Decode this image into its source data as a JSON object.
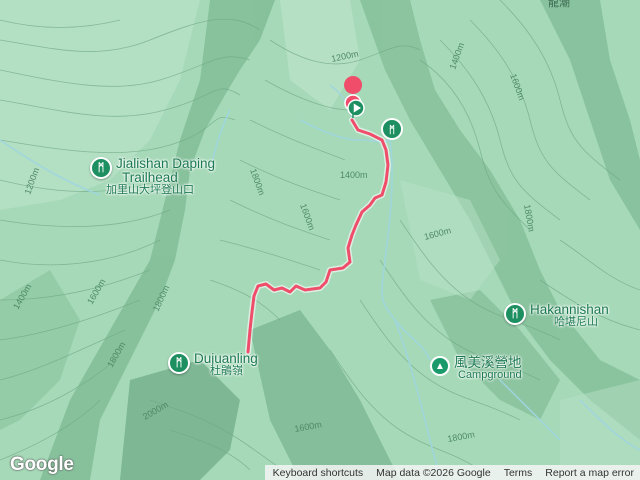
{
  "map": {
    "colors": {
      "terrain": "#a6d9b8",
      "route": "#ef4d6a",
      "poi": "#1e8f60",
      "water": "#9fd6e0"
    },
    "route_color_name": "hiking-route",
    "contour_labels": [
      {
        "text": "1200m"
      },
      {
        "text": "1400m"
      },
      {
        "text": "1600m"
      },
      {
        "text": "1800m"
      },
      {
        "text": "1400m"
      },
      {
        "text": "1600m"
      },
      {
        "text": "1800m"
      },
      {
        "text": "1800m"
      },
      {
        "text": "1600m"
      },
      {
        "text": "1400m"
      },
      {
        "text": "1600m"
      },
      {
        "text": "2000m"
      },
      {
        "text": "1800m"
      },
      {
        "text": "1600m"
      },
      {
        "text": "1800m"
      },
      {
        "text": "1200m"
      }
    ],
    "corner_label": "龍潮"
  },
  "pois": [
    {
      "name": "Jialishan Daping Trailhead",
      "name_line1": "Jialishan Daping",
      "name_line2": "Trailhead",
      "sub": "加里山大坪登山口",
      "icon": "hiker-icon"
    },
    {
      "name": "Hakannishan",
      "sub": "哈堪尼山",
      "icon": "hiker-icon"
    },
    {
      "name": "Dujuanling",
      "sub": "杜鵑嶺",
      "icon": "hiker-icon"
    },
    {
      "name": "風美溪營地",
      "sub": "Campground",
      "icon": "tent-icon"
    }
  ],
  "footer": {
    "logo": "Google",
    "keyboard_shortcuts": "Keyboard shortcuts",
    "map_data": "Map data ©2026 Google",
    "terms": "Terms",
    "report": "Report a map error"
  }
}
